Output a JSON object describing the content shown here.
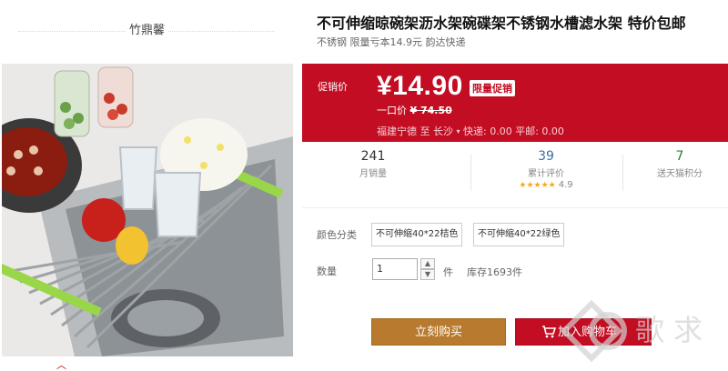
{
  "store": {
    "name": "竹鼎馨"
  },
  "product": {
    "title": "不可伸缩晾碗架沥水架碗碟架不锈钢水槽滤水架 特价包邮",
    "subtitle": "不锈钢 限量亏本14.9元 韵达快递"
  },
  "price": {
    "promo_label": "促销价",
    "current": "¥14.90",
    "badge": "限量促销",
    "original_label": "一口价",
    "original": "¥ 74.50",
    "shipping_from": "福建宁德",
    "shipping_to_label": "至",
    "shipping_to": "长沙",
    "shipping_caret": "▾",
    "express": "快递: 0.00 平邮: 0.00"
  },
  "stats": {
    "monthly_sales": "241",
    "monthly_sales_label": "月销量",
    "reviews": "39",
    "reviews_label": "累计评价",
    "rating_stars": "★★★★★",
    "rating_value": "4.9",
    "points": "7",
    "points_label": "送天猫积分"
  },
  "options": {
    "color_label": "颜色分类",
    "choices": [
      "不可伸缩40*22桔色",
      "不可伸缩40*22绿色"
    ]
  },
  "quantity": {
    "label": "数量",
    "value": "1",
    "unit": "件",
    "stock": "库存1693件",
    "up": "▲",
    "down": "▼"
  },
  "actions": {
    "buy_now": "立刻购买",
    "add_to_cart": "加入购物车"
  },
  "ui": {
    "scroll_up_glyph": "︿",
    "watermark": "歌 求"
  },
  "colors": {
    "price_bg": "#c30d23",
    "buy_btn": "#b77a2f",
    "cart_btn": "#c30d23"
  },
  "icons": [
    "cart-icon",
    "chevron-up-icon",
    "stepper-up-icon",
    "stepper-down-icon"
  ]
}
